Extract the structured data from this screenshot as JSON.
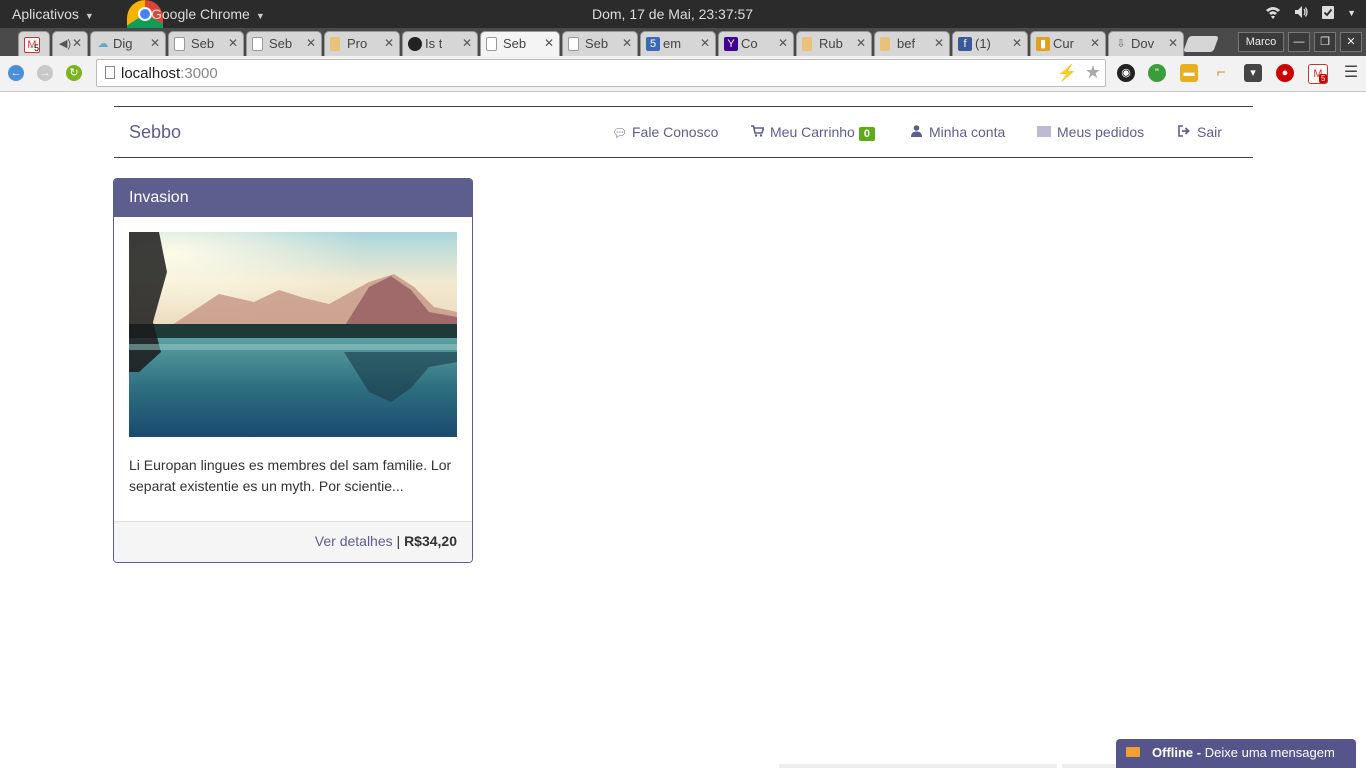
{
  "os_panel": {
    "apps_label": "Aplicativos",
    "active_app": "Google Chrome",
    "datetime": "Dom, 17 de Mai, 23:37:57"
  },
  "tabs": [
    {
      "title": "",
      "icon": "gmail-icon",
      "badge": "5"
    },
    {
      "title": "",
      "icon": "speaker-icon"
    },
    {
      "title": "Dig",
      "icon": "cloud-icon"
    },
    {
      "title": "Seb",
      "icon": "page-icon"
    },
    {
      "title": "Seb",
      "icon": "page-icon"
    },
    {
      "title": "Pro",
      "icon": "doc-icon"
    },
    {
      "title": "Is t",
      "icon": "github-icon"
    },
    {
      "title": "Seb",
      "icon": "page-icon",
      "active": true
    },
    {
      "title": "Seb",
      "icon": "page-icon"
    },
    {
      "title": "em",
      "icon": "html5-icon"
    },
    {
      "title": "Co",
      "icon": "yahoo-icon"
    },
    {
      "title": "Rub",
      "icon": "doc-icon"
    },
    {
      "title": "bef",
      "icon": "doc-icon"
    },
    {
      "title": "(1)",
      "icon": "facebook-icon"
    },
    {
      "title": "Cur",
      "icon": "chart-icon"
    },
    {
      "title": "Dov",
      "icon": "download-icon"
    }
  ],
  "profile_name": "Marco",
  "address_bar": {
    "host": "localhost",
    "port": ":3000"
  },
  "extensions": {
    "gmail_badge": "5"
  },
  "navbar": {
    "brand": "Sebbo",
    "links": {
      "contact": "Fale Conosco",
      "cart": "Meu Carrinho",
      "cart_count": "0",
      "account": "Minha conta",
      "orders": "Meus pedidos",
      "logout": "Sair"
    }
  },
  "product": {
    "title": "Invasion",
    "description": "Li Europan lingues es membres del sam familie. Lor separat existentie es un myth. Por scientie...",
    "details_link": "Ver detalhes",
    "separator": "|",
    "price": "R$34,20"
  },
  "chat_widget": {
    "status": "Offline -",
    "message": "Deixe uma mensagem"
  },
  "colors": {
    "accent": "#5e5e8e",
    "badge": "#5bab1a",
    "chat": "#55558b"
  }
}
